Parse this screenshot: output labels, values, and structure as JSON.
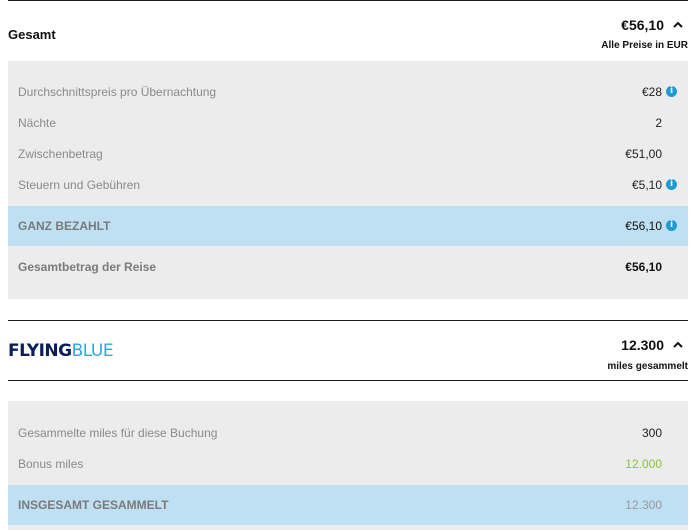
{
  "gesamt": {
    "title": "Gesamt",
    "total": "€56,10",
    "currency_note": "Alle Preise in EUR",
    "rows": [
      {
        "label": "Durchschnittspreis pro Übernachtung",
        "value": "€28"
      },
      {
        "label": "Nächte",
        "value": "2"
      },
      {
        "label": "Zwischenbetrag",
        "value": "€51,00"
      },
      {
        "label": "Steuern und Gebühren",
        "value": "€5,10"
      }
    ],
    "paid": {
      "label": "GANZ BEZAHLT",
      "value": "€56,10"
    },
    "trip_total": {
      "label": "Gesamtbetrag der Reise",
      "value": "€56,10"
    }
  },
  "flyingblue": {
    "logo_part1": "FLYING",
    "logo_part2": "BLUE",
    "total": "12.300",
    "sub": "miles gesammelt",
    "rows": [
      {
        "label": "Gesammelte miles für diese Buchung",
        "value": "300"
      },
      {
        "label": "Bonus miles",
        "value": "12.000"
      }
    ],
    "collected": {
      "label": "INSGESAMT GESAMMELT",
      "value": "12.300"
    }
  },
  "colors": {
    "accent_blue": "#1e9ad6",
    "highlight_row": "#bfe0f2",
    "panel_bg": "#ececec",
    "bonus_green": "#8cc43c"
  },
  "icons": {
    "info": "info-icon",
    "chevron": "chevron-up-icon"
  }
}
